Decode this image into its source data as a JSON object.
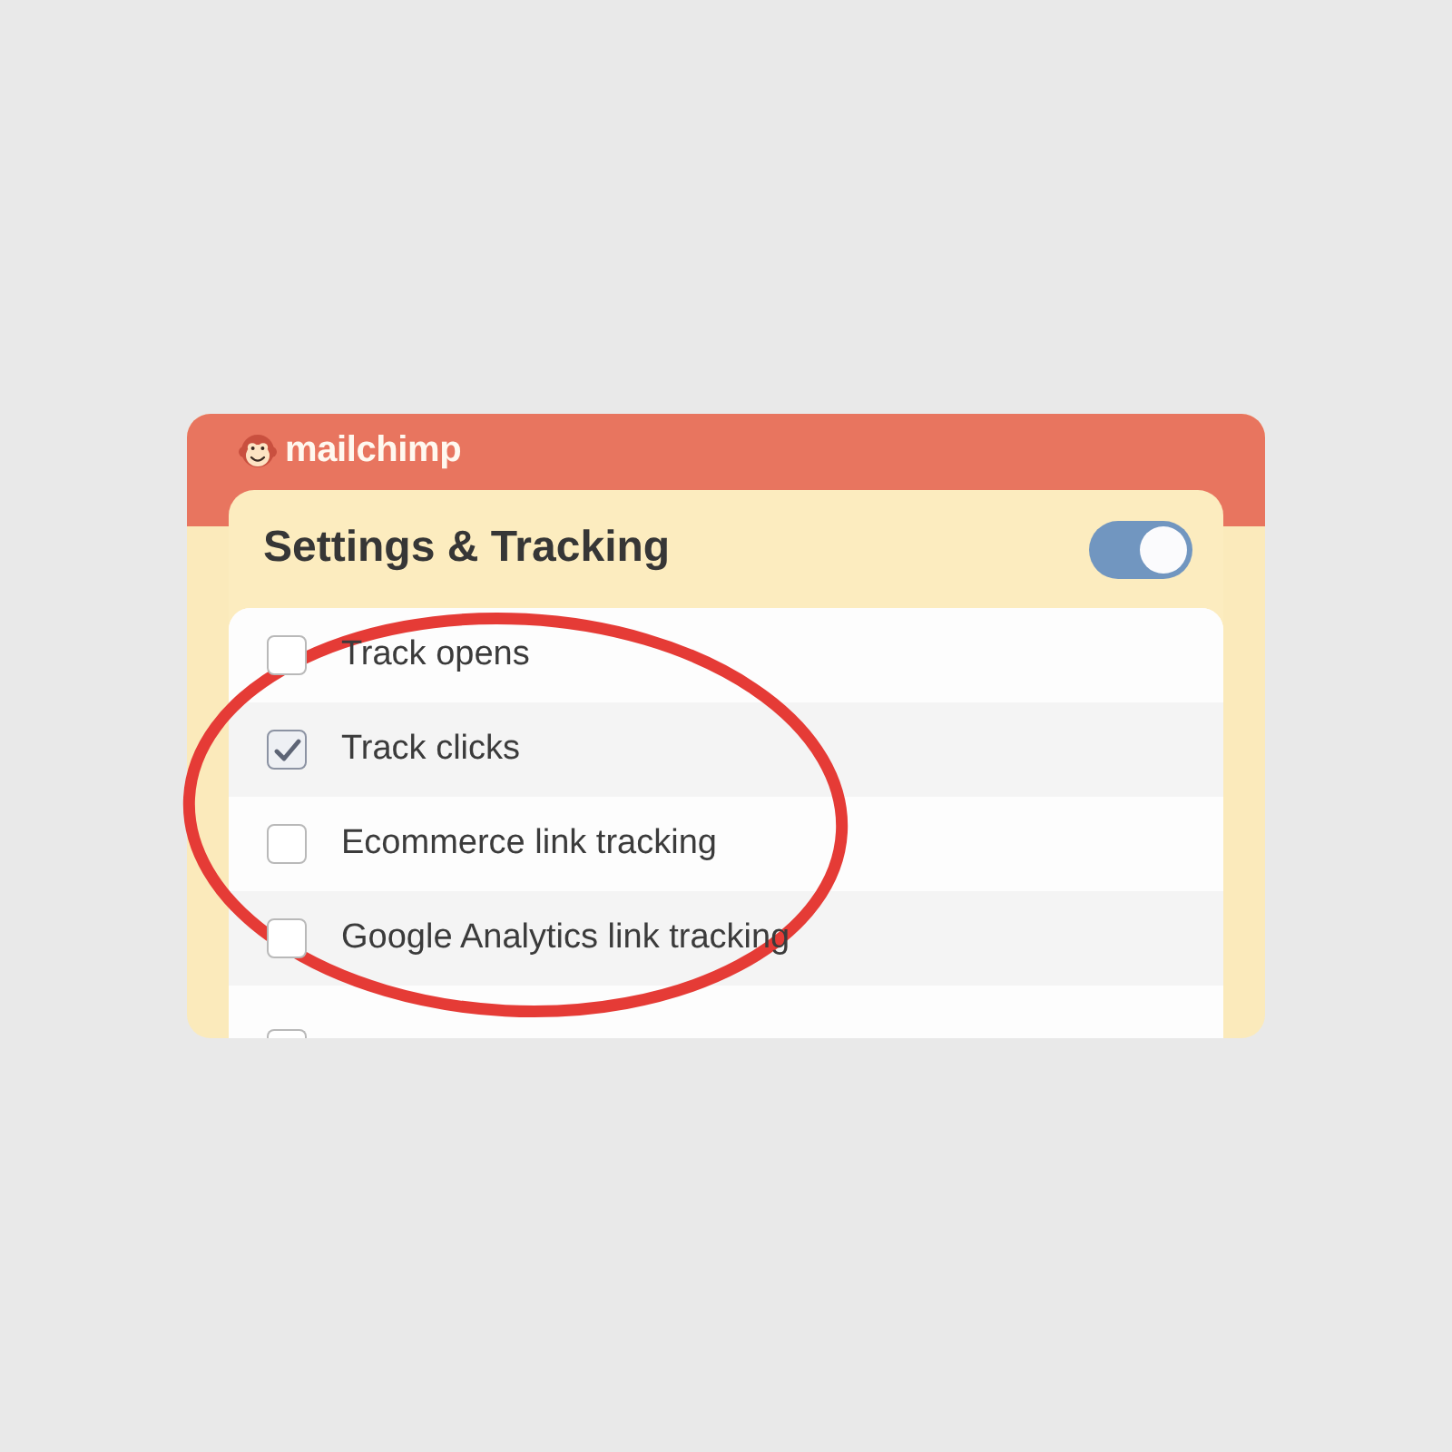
{
  "app": {
    "logo": "mailchimp"
  },
  "panel": {
    "title": "Settings & Tracking",
    "toggle": {
      "on": true
    }
  },
  "options": [
    {
      "kind": "option",
      "label": "Track opens",
      "checked": false
    },
    {
      "kind": "option",
      "label": "Track clicks",
      "checked": true
    },
    {
      "kind": "option",
      "label": "Ecommerce link tracking",
      "checked": false
    },
    {
      "kind": "option",
      "label": "Google Analytics link tracking",
      "checked": false
    },
    {
      "kind": "cut",
      "checked": false
    }
  ],
  "highlight": {
    "kind": "ellipse"
  }
}
